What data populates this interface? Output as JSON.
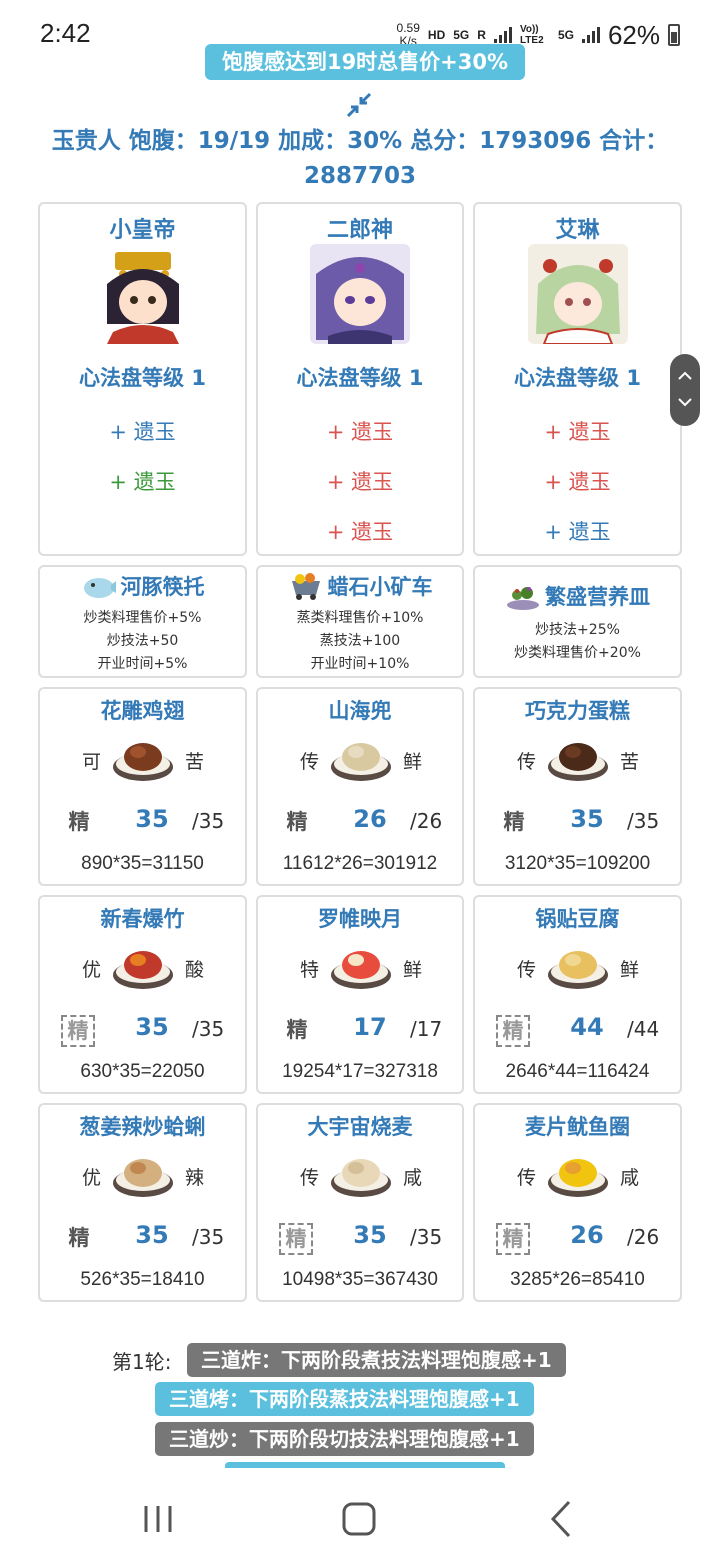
{
  "status_bar": {
    "time": "2:42",
    "net_speed_value": "0.59",
    "net_speed_unit": "K/s",
    "hd": "HD",
    "net1": "5G",
    "r": "R",
    "volte": "Vo)) LTE2",
    "net2": "5G",
    "battery": "62%"
  },
  "banner": "饱腹感达到19时总售价+30%",
  "summary": "玉贵人 饱腹：19/19 加成：30% 总分：1793096 合计：2887703",
  "colors": {
    "accent_blue": "#337ab7",
    "cyan": "#5bc0de",
    "gray_button": "#777777",
    "red": "#d9534f",
    "green": "#3c9a3c"
  },
  "chefs": [
    {
      "name": "小皇帝",
      "level": "心法盘等级 1",
      "jades": [
        {
          "text": "+ 遗玉",
          "color": "blue"
        },
        {
          "text": "+ 遗玉",
          "color": "green"
        }
      ]
    },
    {
      "name": "二郎神",
      "level": "心法盘等级 1",
      "jades": [
        {
          "text": "+ 遗玉",
          "color": "red"
        },
        {
          "text": "+ 遗玉",
          "color": "red"
        },
        {
          "text": "+ 遗玉",
          "color": "red"
        }
      ]
    },
    {
      "name": "艾琳",
      "level": "心法盘等级 1",
      "jades": [
        {
          "text": "+ 遗玉",
          "color": "red"
        },
        {
          "text": "+ 遗玉",
          "color": "red"
        },
        {
          "text": "+ 遗玉",
          "color": "blue"
        }
      ]
    }
  ],
  "equipment": [
    {
      "name": "河豚筷托",
      "icon": "pufferfish-icon",
      "lines": [
        "炒类料理售价+5%",
        "炒技法+50",
        "开业时间+5%"
      ]
    },
    {
      "name": "蜡石小矿车",
      "icon": "mine-cart-icon",
      "lines": [
        "蒸类料理售价+10%",
        "蒸技法+100",
        "开业时间+10%"
      ]
    },
    {
      "name": "繁盛营养皿",
      "icon": "plant-dish-icon",
      "lines": [
        "炒技法+25%",
        "炒类料理售价+20%"
      ]
    }
  ],
  "dishes": [
    [
      {
        "name": "花雕鸡翅",
        "left": "可",
        "right": "苦",
        "skill": "精",
        "skill_dashed": false,
        "count": "35",
        "max": "/35",
        "formula": "890*35=31150"
      },
      {
        "name": "山海兜",
        "left": "传",
        "right": "鲜",
        "skill": "精",
        "skill_dashed": false,
        "count": "26",
        "max": "/26",
        "formula": "11612*26=301912"
      },
      {
        "name": "巧克力蛋糕",
        "left": "传",
        "right": "苦",
        "skill": "精",
        "skill_dashed": false,
        "count": "35",
        "max": "/35",
        "formula": "3120*35=109200"
      }
    ],
    [
      {
        "name": "新春爆竹",
        "left": "优",
        "right": "酸",
        "skill": "精",
        "skill_dashed": true,
        "count": "35",
        "max": "/35",
        "formula": "630*35=22050"
      },
      {
        "name": "罗帷映月",
        "left": "特",
        "right": "鲜",
        "skill": "精",
        "skill_dashed": false,
        "count": "17",
        "max": "/17",
        "formula": "19254*17=327318"
      },
      {
        "name": "锅贴豆腐",
        "left": "传",
        "right": "鲜",
        "skill": "精",
        "skill_dashed": true,
        "count": "44",
        "max": "/44",
        "formula": "2646*44=116424"
      }
    ],
    [
      {
        "name": "葱姜辣炒蛤蜊",
        "left": "优",
        "right": "辣",
        "skill": "精",
        "skill_dashed": false,
        "count": "35",
        "max": "/35",
        "formula": "526*35=18410"
      },
      {
        "name": "大宇宙烧麦",
        "left": "传",
        "right": "咸",
        "skill": "精",
        "skill_dashed": true,
        "count": "35",
        "max": "/35",
        "formula": "10498*35=367430"
      },
      {
        "name": "麦片鱿鱼圈",
        "left": "传",
        "right": "咸",
        "skill": "精",
        "skill_dashed": true,
        "count": "26",
        "max": "/26",
        "formula": "3285*26=85410"
      }
    ]
  ],
  "rounds": {
    "label": "第1轮:",
    "items": [
      {
        "text": "三道炸：下两阶段煮技法料理饱腹感+1",
        "style": "gray"
      },
      {
        "text": "三道烤：下两阶段蒸技法料理饱腹感+1",
        "style": "cyan"
      },
      {
        "text": "三道炒：下两阶段切技法料理饱腹感+1",
        "style": "gray"
      }
    ]
  }
}
